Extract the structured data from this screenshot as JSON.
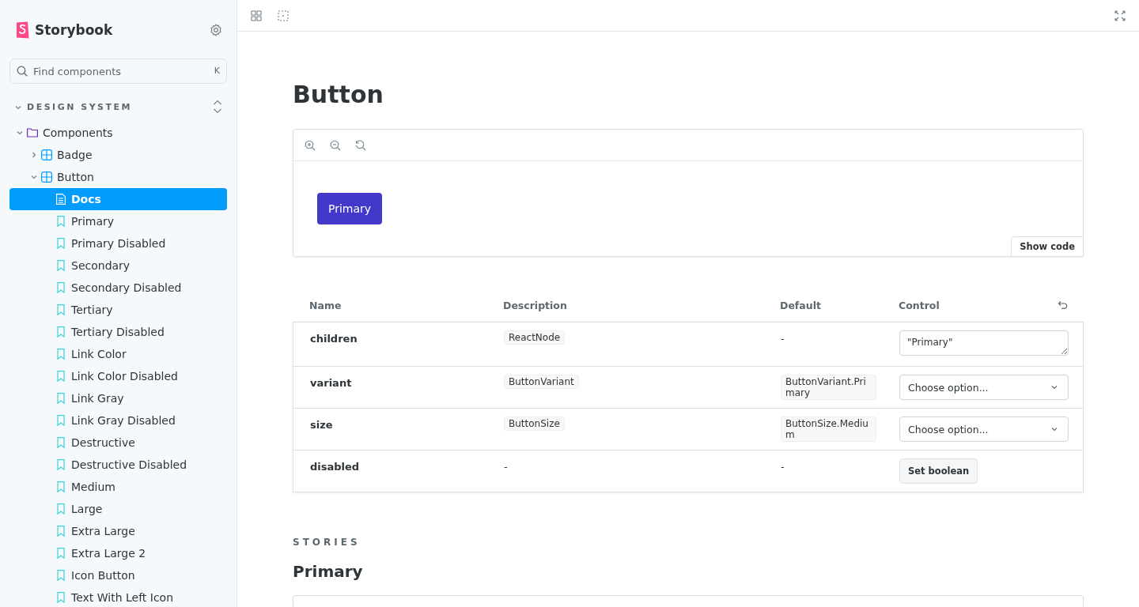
{
  "sidebar": {
    "brand": "Storybook",
    "search": {
      "placeholder": "Find components",
      "shortcut": "K"
    },
    "section": {
      "label": "DESIGN SYSTEM",
      "expanded": true
    },
    "tree": [
      {
        "label": "Components",
        "kind": "folder",
        "expanded": true,
        "selected": false,
        "children": [
          {
            "label": "Badge",
            "kind": "component",
            "expanded": false,
            "selected": false
          },
          {
            "label": "Button",
            "kind": "component",
            "expanded": true,
            "selected": false,
            "children": [
              {
                "label": "Docs",
                "kind": "docs",
                "selected": true
              },
              {
                "label": "Primary",
                "kind": "story",
                "selected": false
              },
              {
                "label": "Primary Disabled",
                "kind": "story",
                "selected": false
              },
              {
                "label": "Secondary",
                "kind": "story",
                "selected": false
              },
              {
                "label": "Secondary Disabled",
                "kind": "story",
                "selected": false
              },
              {
                "label": "Tertiary",
                "kind": "story",
                "selected": false
              },
              {
                "label": "Tertiary Disabled",
                "kind": "story",
                "selected": false
              },
              {
                "label": "Link Color",
                "kind": "story",
                "selected": false
              },
              {
                "label": "Link Color Disabled",
                "kind": "story",
                "selected": false
              },
              {
                "label": "Link Gray",
                "kind": "story",
                "selected": false
              },
              {
                "label": "Link Gray Disabled",
                "kind": "story",
                "selected": false
              },
              {
                "label": "Destructive",
                "kind": "story",
                "selected": false
              },
              {
                "label": "Destructive Disabled",
                "kind": "story",
                "selected": false
              },
              {
                "label": "Medium",
                "kind": "story",
                "selected": false
              },
              {
                "label": "Large",
                "kind": "story",
                "selected": false
              },
              {
                "label": "Extra Large",
                "kind": "story",
                "selected": false
              },
              {
                "label": "Extra Large 2",
                "kind": "story",
                "selected": false
              },
              {
                "label": "Icon Button",
                "kind": "story",
                "selected": false
              },
              {
                "label": "Text With Left Icon",
                "kind": "story",
                "selected": false
              }
            ]
          }
        ]
      }
    ]
  },
  "main": {
    "title": "Button",
    "preview": {
      "button": "Primary",
      "show_code": "Show code"
    },
    "args_table": {
      "columns": [
        "Name",
        "Description",
        "Default",
        "Control"
      ],
      "rows": [
        {
          "name": "children",
          "description": {
            "kind": "code",
            "text": "ReactNode"
          },
          "default": {
            "kind": "text",
            "text": "-"
          },
          "control": {
            "kind": "textarea",
            "value": "\"Primary\""
          }
        },
        {
          "name": "variant",
          "description": {
            "kind": "code",
            "text": "ButtonVariant"
          },
          "default": {
            "kind": "code",
            "text": "ButtonVariant.Primary"
          },
          "control": {
            "kind": "select",
            "placeholder": "Choose option..."
          }
        },
        {
          "name": "size",
          "description": {
            "kind": "code",
            "text": "ButtonSize"
          },
          "default": {
            "kind": "code",
            "text": "ButtonSize.Medium"
          },
          "control": {
            "kind": "select",
            "placeholder": "Choose option..."
          }
        },
        {
          "name": "disabled",
          "description": {
            "kind": "text",
            "text": "-"
          },
          "default": {
            "kind": "text",
            "text": "-"
          },
          "control": {
            "kind": "button",
            "label": "Set boolean"
          }
        }
      ]
    },
    "stories_heading": "STORIES",
    "story_title": "Primary"
  }
}
